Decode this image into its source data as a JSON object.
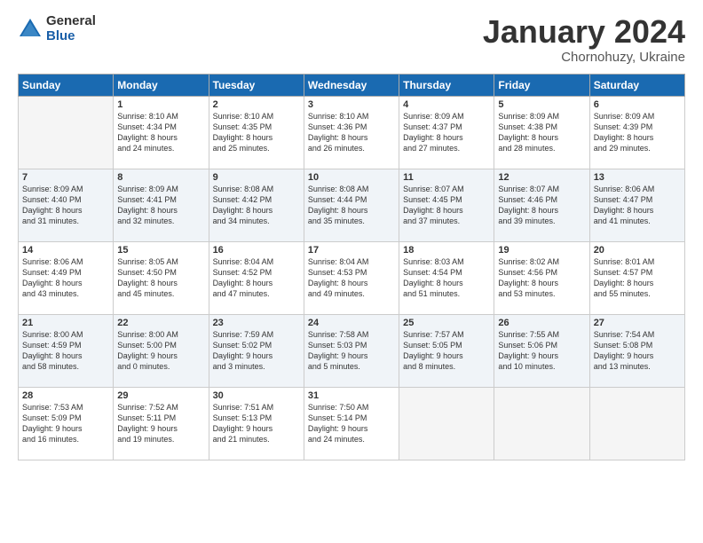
{
  "logo": {
    "general": "General",
    "blue": "Blue"
  },
  "title": "January 2024",
  "location": "Chornohuzy, Ukraine",
  "days_header": [
    "Sunday",
    "Monday",
    "Tuesday",
    "Wednesday",
    "Thursday",
    "Friday",
    "Saturday"
  ],
  "weeks": [
    [
      {
        "day": "",
        "info": ""
      },
      {
        "day": "1",
        "info": "Sunrise: 8:10 AM\nSunset: 4:34 PM\nDaylight: 8 hours\nand 24 minutes."
      },
      {
        "day": "2",
        "info": "Sunrise: 8:10 AM\nSunset: 4:35 PM\nDaylight: 8 hours\nand 25 minutes."
      },
      {
        "day": "3",
        "info": "Sunrise: 8:10 AM\nSunset: 4:36 PM\nDaylight: 8 hours\nand 26 minutes."
      },
      {
        "day": "4",
        "info": "Sunrise: 8:09 AM\nSunset: 4:37 PM\nDaylight: 8 hours\nand 27 minutes."
      },
      {
        "day": "5",
        "info": "Sunrise: 8:09 AM\nSunset: 4:38 PM\nDaylight: 8 hours\nand 28 minutes."
      },
      {
        "day": "6",
        "info": "Sunrise: 8:09 AM\nSunset: 4:39 PM\nDaylight: 8 hours\nand 29 minutes."
      }
    ],
    [
      {
        "day": "7",
        "info": "Sunrise: 8:09 AM\nSunset: 4:40 PM\nDaylight: 8 hours\nand 31 minutes."
      },
      {
        "day": "8",
        "info": "Sunrise: 8:09 AM\nSunset: 4:41 PM\nDaylight: 8 hours\nand 32 minutes."
      },
      {
        "day": "9",
        "info": "Sunrise: 8:08 AM\nSunset: 4:42 PM\nDaylight: 8 hours\nand 34 minutes."
      },
      {
        "day": "10",
        "info": "Sunrise: 8:08 AM\nSunset: 4:44 PM\nDaylight: 8 hours\nand 35 minutes."
      },
      {
        "day": "11",
        "info": "Sunrise: 8:07 AM\nSunset: 4:45 PM\nDaylight: 8 hours\nand 37 minutes."
      },
      {
        "day": "12",
        "info": "Sunrise: 8:07 AM\nSunset: 4:46 PM\nDaylight: 8 hours\nand 39 minutes."
      },
      {
        "day": "13",
        "info": "Sunrise: 8:06 AM\nSunset: 4:47 PM\nDaylight: 8 hours\nand 41 minutes."
      }
    ],
    [
      {
        "day": "14",
        "info": "Sunrise: 8:06 AM\nSunset: 4:49 PM\nDaylight: 8 hours\nand 43 minutes."
      },
      {
        "day": "15",
        "info": "Sunrise: 8:05 AM\nSunset: 4:50 PM\nDaylight: 8 hours\nand 45 minutes."
      },
      {
        "day": "16",
        "info": "Sunrise: 8:04 AM\nSunset: 4:52 PM\nDaylight: 8 hours\nand 47 minutes."
      },
      {
        "day": "17",
        "info": "Sunrise: 8:04 AM\nSunset: 4:53 PM\nDaylight: 8 hours\nand 49 minutes."
      },
      {
        "day": "18",
        "info": "Sunrise: 8:03 AM\nSunset: 4:54 PM\nDaylight: 8 hours\nand 51 minutes."
      },
      {
        "day": "19",
        "info": "Sunrise: 8:02 AM\nSunset: 4:56 PM\nDaylight: 8 hours\nand 53 minutes."
      },
      {
        "day": "20",
        "info": "Sunrise: 8:01 AM\nSunset: 4:57 PM\nDaylight: 8 hours\nand 55 minutes."
      }
    ],
    [
      {
        "day": "21",
        "info": "Sunrise: 8:00 AM\nSunset: 4:59 PM\nDaylight: 8 hours\nand 58 minutes."
      },
      {
        "day": "22",
        "info": "Sunrise: 8:00 AM\nSunset: 5:00 PM\nDaylight: 9 hours\nand 0 minutes."
      },
      {
        "day": "23",
        "info": "Sunrise: 7:59 AM\nSunset: 5:02 PM\nDaylight: 9 hours\nand 3 minutes."
      },
      {
        "day": "24",
        "info": "Sunrise: 7:58 AM\nSunset: 5:03 PM\nDaylight: 9 hours\nand 5 minutes."
      },
      {
        "day": "25",
        "info": "Sunrise: 7:57 AM\nSunset: 5:05 PM\nDaylight: 9 hours\nand 8 minutes."
      },
      {
        "day": "26",
        "info": "Sunrise: 7:55 AM\nSunset: 5:06 PM\nDaylight: 9 hours\nand 10 minutes."
      },
      {
        "day": "27",
        "info": "Sunrise: 7:54 AM\nSunset: 5:08 PM\nDaylight: 9 hours\nand 13 minutes."
      }
    ],
    [
      {
        "day": "28",
        "info": "Sunrise: 7:53 AM\nSunset: 5:09 PM\nDaylight: 9 hours\nand 16 minutes."
      },
      {
        "day": "29",
        "info": "Sunrise: 7:52 AM\nSunset: 5:11 PM\nDaylight: 9 hours\nand 19 minutes."
      },
      {
        "day": "30",
        "info": "Sunrise: 7:51 AM\nSunset: 5:13 PM\nDaylight: 9 hours\nand 21 minutes."
      },
      {
        "day": "31",
        "info": "Sunrise: 7:50 AM\nSunset: 5:14 PM\nDaylight: 9 hours\nand 24 minutes."
      },
      {
        "day": "",
        "info": ""
      },
      {
        "day": "",
        "info": ""
      },
      {
        "day": "",
        "info": ""
      }
    ]
  ]
}
